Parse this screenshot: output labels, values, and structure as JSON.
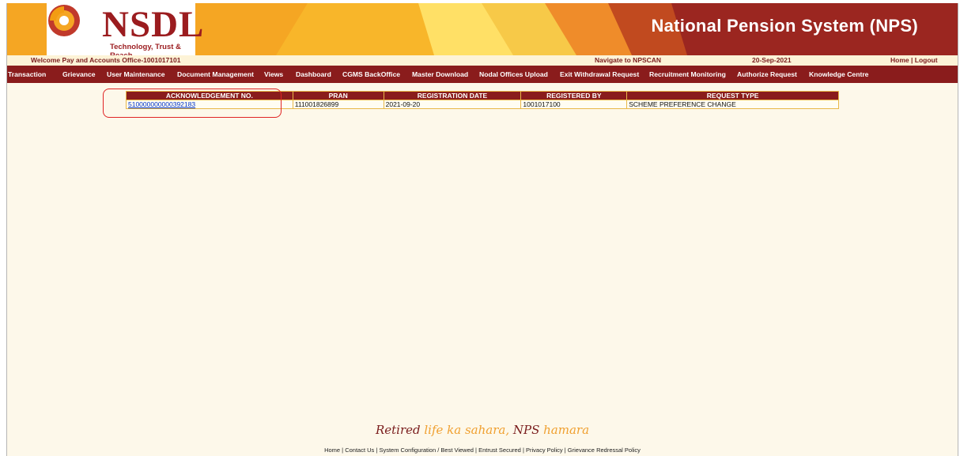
{
  "header": {
    "logo_text": "NSDL",
    "logo_tagline": "Technology, Trust & Reach",
    "system_title": "National Pension System (NPS)"
  },
  "info_bar": {
    "welcome": "Welcome Pay and Accounts Office-1001017101",
    "navigate": "Navigate to NPSCAN",
    "date": "20-Sep-2021",
    "home": "Home",
    "separator": "|",
    "logout": "Logout"
  },
  "menu": [
    {
      "label": "Transaction"
    },
    {
      "label": "Grievance"
    },
    {
      "label": "User Maintenance"
    },
    {
      "label": "Document Management"
    },
    {
      "label": "Views"
    },
    {
      "label": "Dashboard"
    },
    {
      "label": "CGMS BackOffice"
    },
    {
      "label": "Master Download"
    },
    {
      "label": "Nodal Offices Upload"
    },
    {
      "label": "Exit Withdrawal Request"
    },
    {
      "label": "Recruitment Monitoring"
    },
    {
      "label": "Authorize Request"
    },
    {
      "label": "Knowledge Centre"
    }
  ],
  "table": {
    "headers": [
      "ACKNOWLEDGEMENT NO.",
      "PRAN",
      "REGISTRATION DATE",
      "REGISTERED BY",
      "REQUEST TYPE"
    ],
    "rows": [
      {
        "ack_no": "510000000000392183",
        "pran": "111001826899",
        "registration_date": "2021-09-20",
        "registered_by": "1001017100",
        "request_type": "SCHEME PREFERENCE CHANGE"
      }
    ]
  },
  "slogan": {
    "part1": "Retired ",
    "part2": "life ka sahara, ",
    "part3": "NPS ",
    "part4": "hamara"
  },
  "footer": {
    "links": [
      "Home",
      "Contact Us",
      "System Configuration / Best Viewed",
      "Entrust Secured",
      "Privacy Policy",
      "Grievance Redressal Policy"
    ],
    "separator": " | "
  },
  "colors": {
    "maroon": "#8a1c1c",
    "orange": "#f5a623",
    "cream": "#fdf8ea",
    "link_blue": "#0033cc",
    "highlight_red": "#e02424"
  }
}
